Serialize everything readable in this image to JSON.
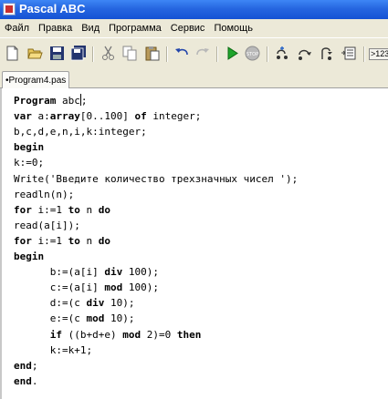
{
  "window": {
    "title": "Pascal ABC"
  },
  "menu": [
    "Файл",
    "Правка",
    "Вид",
    "Программа",
    "Сервис",
    "Помощь"
  ],
  "toolbar": {
    "icons": [
      "new-file-icon",
      "open-folder-icon",
      "save-icon",
      "save-all-icon",
      "cut-icon",
      "copy-icon",
      "paste-icon",
      "undo-icon",
      "redo-icon",
      "run-icon",
      "stop-icon",
      "step-into-icon",
      "step-over-icon",
      "step-out-icon",
      "output-window-icon"
    ],
    "extra_label": ">123"
  },
  "tabs": [
    {
      "label": "•Program4.pas",
      "active": true
    }
  ],
  "editor": {
    "lines": [
      [
        {
          "t": "Program",
          "k": true
        },
        {
          "t": " abc"
        },
        {
          "caret": true
        },
        {
          "t": ";"
        }
      ],
      [
        {
          "t": "var",
          "k": true
        },
        {
          "t": " a:"
        },
        {
          "t": "array",
          "k": true
        },
        {
          "t": "[0..100] "
        },
        {
          "t": "of",
          "k": true
        },
        {
          "t": " integer;"
        }
      ],
      [
        {
          "t": "b,c,d,e,n,i,k:integer;"
        }
      ],
      [
        {
          "t": "begin",
          "k": true
        }
      ],
      [
        {
          "t": "k:=0;"
        }
      ],
      [
        {
          "t": "Write('Введите количество трехзначных чисел ');"
        }
      ],
      [
        {
          "t": "readln(n);"
        }
      ],
      [
        {
          "t": "for",
          "k": true
        },
        {
          "t": " i:=1 "
        },
        {
          "t": "to",
          "k": true
        },
        {
          "t": " n "
        },
        {
          "t": "do",
          "k": true
        }
      ],
      [
        {
          "t": "read(a[i]);"
        }
      ],
      [
        {
          "t": "for",
          "k": true
        },
        {
          "t": " i:=1 "
        },
        {
          "t": "to",
          "k": true
        },
        {
          "t": " n "
        },
        {
          "t": "do",
          "k": true
        }
      ],
      [
        {
          "t": "begin",
          "k": true
        }
      ],
      [
        {
          "t": "      b:=(a[i] "
        },
        {
          "t": "div",
          "k": true
        },
        {
          "t": " 100);"
        }
      ],
      [
        {
          "t": "      c:=(a[i] "
        },
        {
          "t": "mod",
          "k": true
        },
        {
          "t": " 100);"
        }
      ],
      [
        {
          "t": "      d:=(c "
        },
        {
          "t": "div",
          "k": true
        },
        {
          "t": " 10);"
        }
      ],
      [
        {
          "t": "      e:=(c "
        },
        {
          "t": "mod",
          "k": true
        },
        {
          "t": " 10);"
        }
      ],
      [
        {
          "t": "      "
        },
        {
          "t": "if",
          "k": true
        },
        {
          "t": " ((b+d+e) "
        },
        {
          "t": "mod",
          "k": true
        },
        {
          "t": " 2)=0 "
        },
        {
          "t": "then",
          "k": true
        }
      ],
      [
        {
          "t": "      k:=k+1;"
        }
      ],
      [
        {
          "t": "end",
          "k": true
        },
        {
          "t": ";"
        }
      ],
      [
        {
          "t": "end",
          "k": true
        },
        {
          "t": "."
        }
      ]
    ]
  }
}
